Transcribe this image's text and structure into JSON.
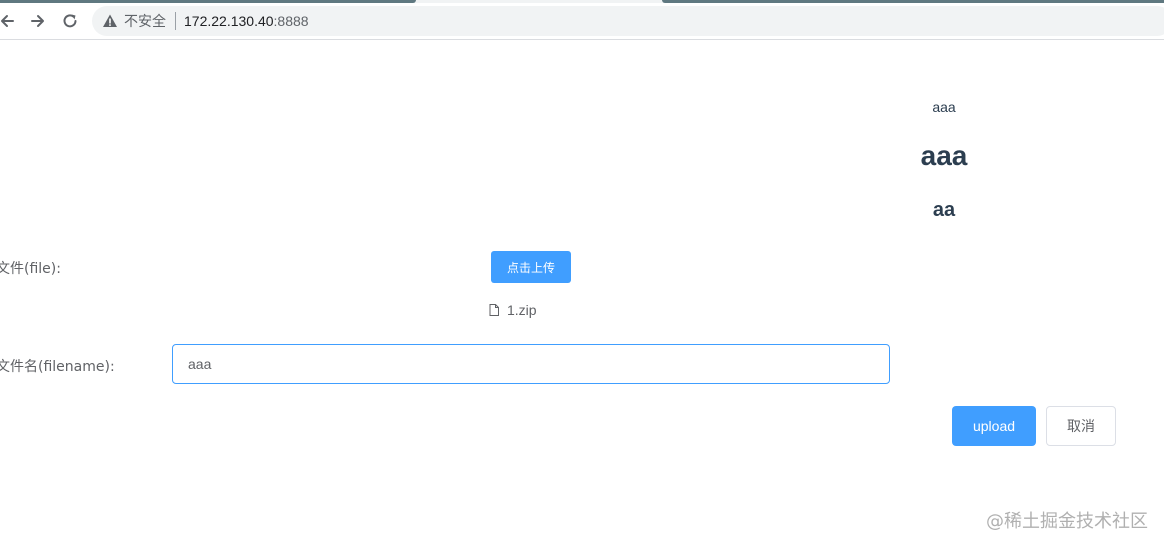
{
  "browser": {
    "security_label": "不安全",
    "url_host": "172.22.130.40",
    "url_port": ":8888",
    "accent_color": "#5f7880"
  },
  "page": {
    "title_small": "aaa",
    "title_h1": "aaa",
    "title_h3": "aa"
  },
  "form": {
    "file_label": "文件(file):",
    "upload_trigger_label": "点击上传",
    "file_list": [
      {
        "icon": "document-icon",
        "name": "1.zip"
      }
    ],
    "filename_label": "文件名(filename):",
    "filename_value": "aaa",
    "submit_label": "upload",
    "cancel_label": "取消",
    "primary_color": "#409eff"
  },
  "watermark": "@稀土掘金技术社区"
}
